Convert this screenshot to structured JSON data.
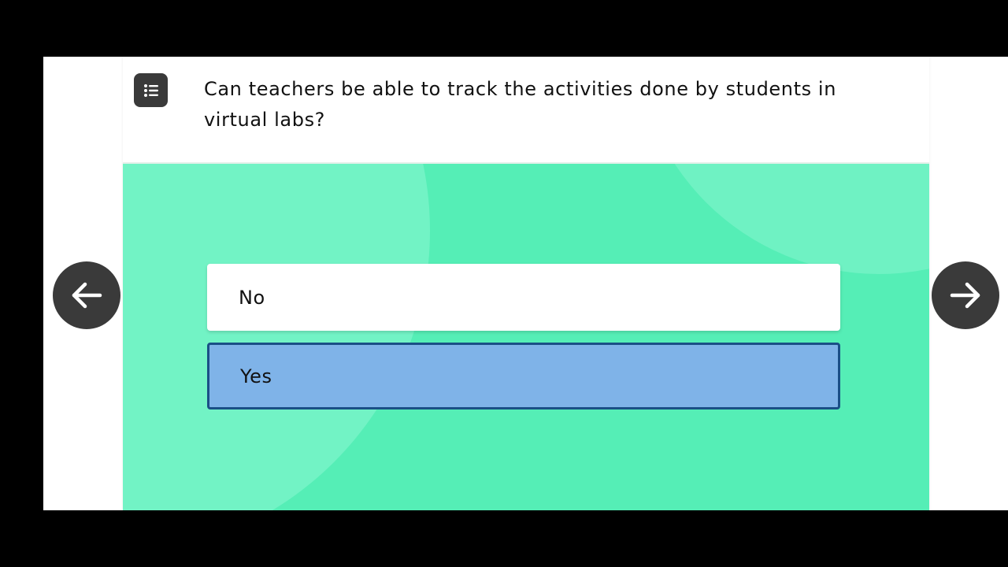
{
  "question": {
    "text": "Can teachers be able to track the activities done by students in virtual labs?",
    "icon": "list-icon"
  },
  "options": [
    {
      "label": "No",
      "selected": false
    },
    {
      "label": "Yes",
      "selected": true
    }
  ],
  "navigation": {
    "prev_icon": "arrow-left-icon",
    "next_icon": "arrow-right-icon"
  },
  "colors": {
    "answer_background": "#55eeb6",
    "selected_option": "#7fb3e8",
    "selected_border": "#1a4f86",
    "nav_button": "#3a3a3a"
  }
}
